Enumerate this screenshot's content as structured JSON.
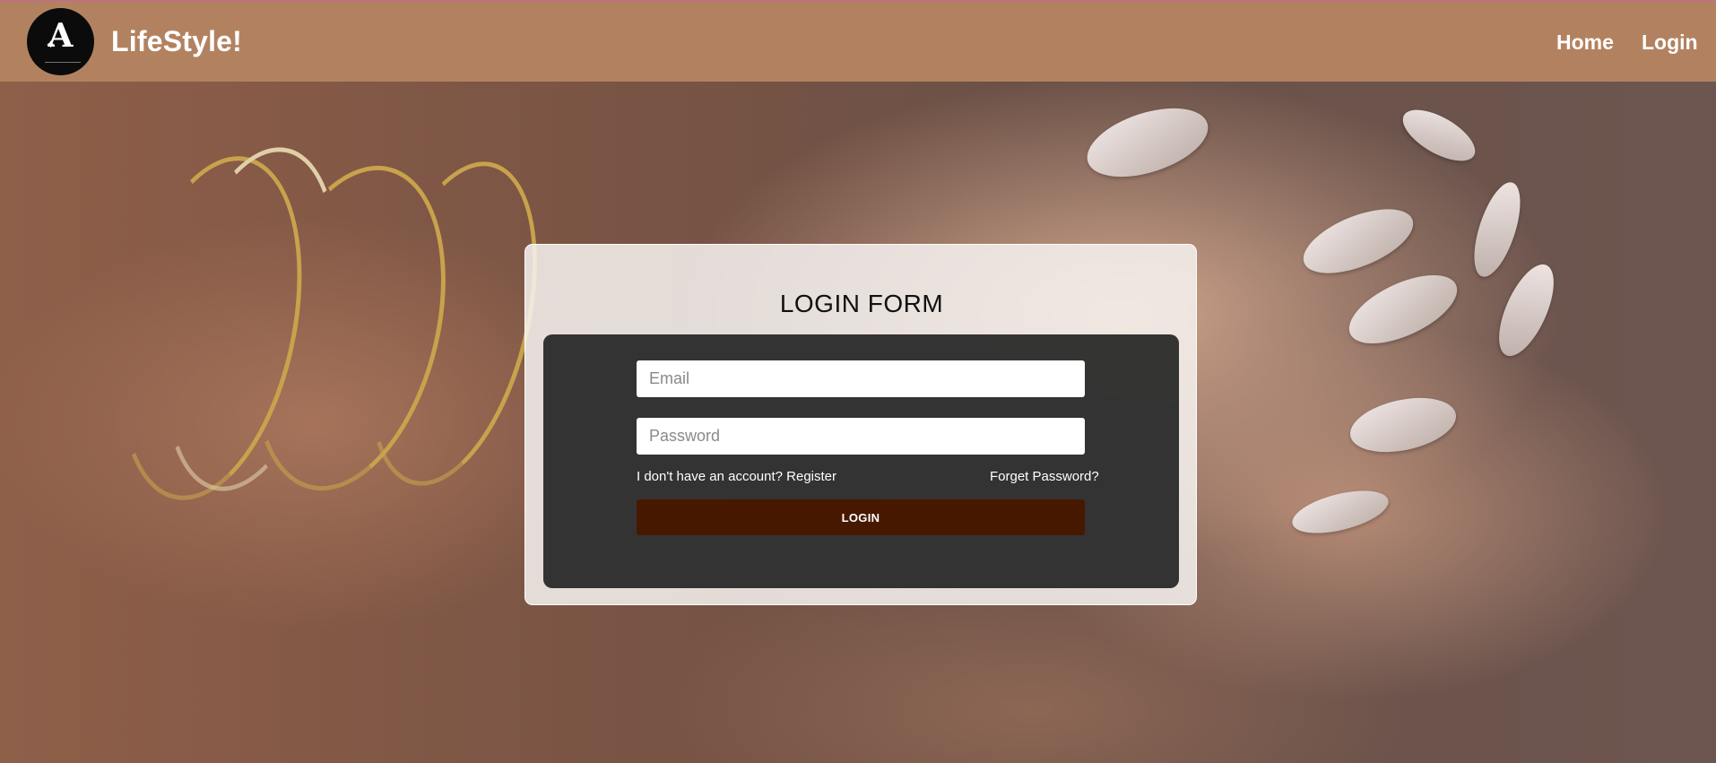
{
  "navbar": {
    "logo_letter": "A",
    "brand": "LifeStyle!",
    "links": {
      "home": "Home",
      "login": "Login"
    }
  },
  "login_form": {
    "title": "LOGIN FORM",
    "email_placeholder": "Email",
    "password_placeholder": "Password",
    "register_link": "I don't have an account? Register",
    "forgot_link": "Forget Password?",
    "submit_label": "LOGIN"
  },
  "colors": {
    "navbar": "#b28260",
    "accent_top_line": "#c0717e",
    "form_panel": "#2d2d2d",
    "login_button": "#461800"
  }
}
